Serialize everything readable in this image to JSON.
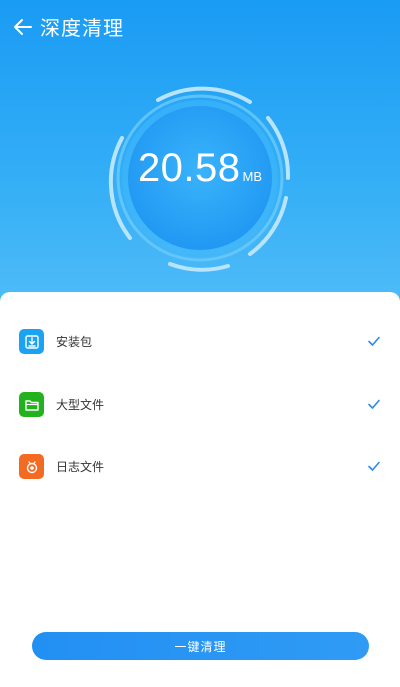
{
  "header": {
    "title": "深度清理",
    "back_icon": "arrow-left-icon"
  },
  "gauge": {
    "value": "20.58",
    "unit": "MB"
  },
  "items": [
    {
      "label": "安装包",
      "icon": "download-icon",
      "icon_color": "#1aa3f5",
      "checked": true
    },
    {
      "label": "大型文件",
      "icon": "folder-icon",
      "icon_color": "#22b21e",
      "checked": true
    },
    {
      "label": "日志文件",
      "icon": "log-icon",
      "icon_color": "#f36a22",
      "checked": true
    }
  ],
  "action": {
    "clean_label": "一键清理"
  },
  "colors": {
    "accent": "#2196f3",
    "check": "#2a8cf0"
  }
}
